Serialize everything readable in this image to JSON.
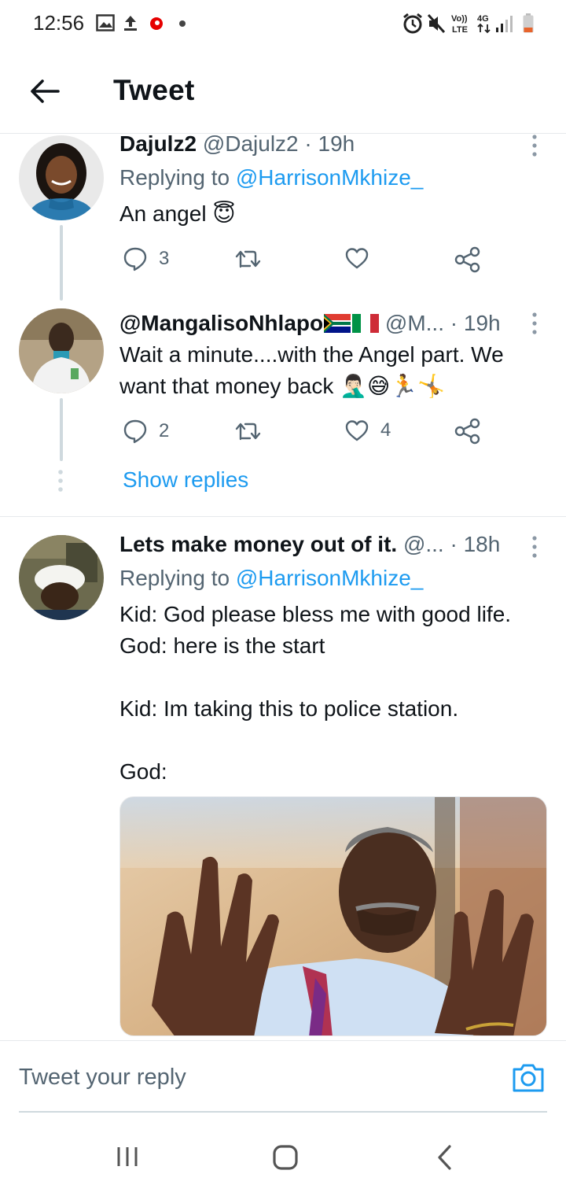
{
  "status_bar": {
    "time": "12:56",
    "icons_left": [
      "gallery-icon",
      "upload-icon",
      "vodafone-icon",
      "dot-icon"
    ],
    "icons_right": [
      "alarm-icon",
      "mute-icon",
      "volte-icon",
      "4g-icon",
      "signal-icon",
      "battery-icon"
    ],
    "volte_label": "Vo))\nLTE",
    "network_label": "4G"
  },
  "header": {
    "title": "Tweet",
    "back_icon": "arrow-left-icon"
  },
  "colors": {
    "link": "#1d9bf0",
    "secondary_text": "#536471",
    "primary_text": "#0f1419",
    "thread_line": "#cfd9de"
  },
  "tweets": [
    {
      "display_name": "Dajulz2",
      "handle": "@Dajulz2",
      "time": "· 19h",
      "replying_to_label": "Replying to",
      "replying_to_handle": "@HarrisonMkhize_",
      "text": "An angel",
      "emoji": "😇",
      "replies": "3",
      "retweets": "",
      "likes": ""
    },
    {
      "display_name": "@MangalisoNhlapo",
      "flags": [
        "🇿🇦",
        "🇮🇹"
      ],
      "handle": "@M...",
      "time": "· 19h",
      "text_line1": "Wait a minute....with the Angel part. We",
      "text_line2": "want that money back",
      "emojis": [
        "🤦🏻‍♂️",
        "😅",
        "🏃",
        "🤸"
      ],
      "replies": "2",
      "retweets": "",
      "likes": "4"
    },
    {
      "display_name": "Lets make money out of it.",
      "handle": "@...",
      "time": "· 18h",
      "replying_to_label": "Replying to",
      "replying_to_handle": "@HarrisonMkhize_",
      "lines": [
        "Kid: God please bless me with good life.",
        "God: here is the start",
        "",
        "Kid: Im taking this to police station.",
        "",
        "God:"
      ],
      "media_description_icon": "photo-icon"
    }
  ],
  "show_replies": "Show replies",
  "reply_bar": {
    "placeholder": "Tweet your reply",
    "camera_icon": "camera-icon"
  },
  "nav": {
    "recents_icon": "recents-icon",
    "home_icon": "home-icon",
    "back_icon": "back-chevron-icon"
  }
}
